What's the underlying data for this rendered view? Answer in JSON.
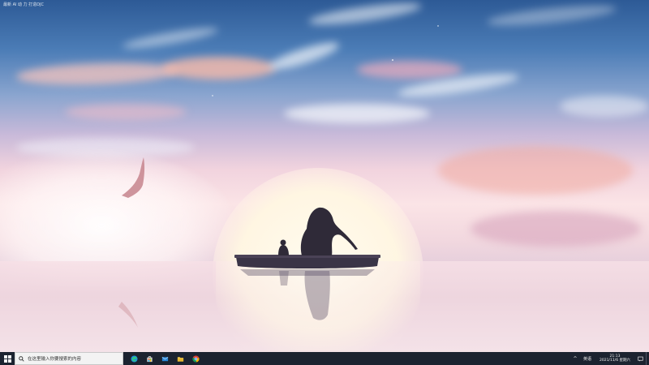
{
  "desktop": {
    "top_caption": "最新 Al 动 力 打造DJC"
  },
  "taskbar": {
    "search_placeholder": "在这里输入你要搜索的内容",
    "pinned_apps": [
      "edge-icon",
      "store-icon",
      "mail-icon",
      "file-explorer-icon",
      "chrome-icon"
    ],
    "tray": {
      "chevron": "^",
      "ime_label": "英语",
      "time": "21:13",
      "date": "2021/11/6 星期六"
    }
  },
  "colors": {
    "taskbar_bg": "#1c2330",
    "search_bg": "#f3f3f3",
    "sky_top": "#2d5a96",
    "sun_glow": "#fff6e2"
  }
}
